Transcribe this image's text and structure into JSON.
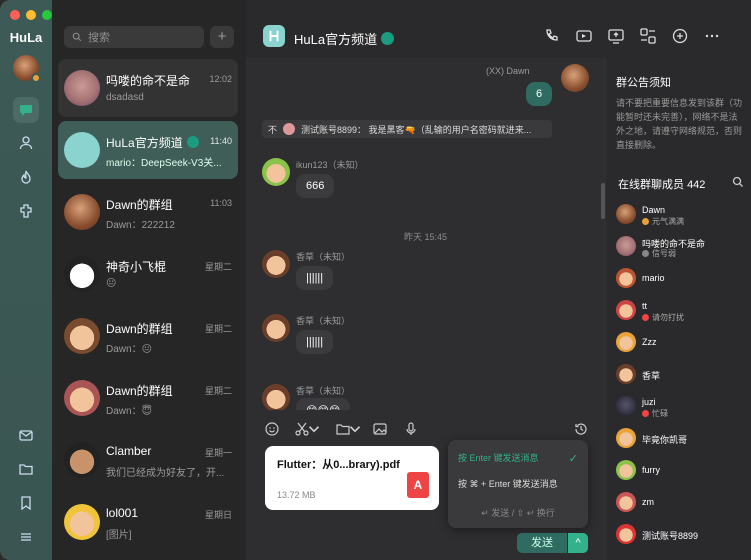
{
  "app": {
    "name": "HuLa"
  },
  "sidebar": {
    "items": [
      "message",
      "contacts",
      "hot",
      "plugins",
      "mail",
      "folder",
      "bookmark",
      "menu"
    ]
  },
  "search": {
    "placeholder": "搜索",
    "add_label": "+"
  },
  "chats": [
    {
      "name": "吗喽的命不是命",
      "time": "12:02",
      "preview": "dsadasd"
    },
    {
      "name": "HuLa官方频道",
      "time": "11:40",
      "preview": "mario：DeepSeek-V3关..."
    },
    {
      "name": "Dawn的群组",
      "time": "11:03",
      "preview": "Dawn：222212"
    },
    {
      "name": "神奇小飞棍",
      "time": "星期二",
      "preview": "😐"
    },
    {
      "name": "Dawn的群组",
      "time": "星期二",
      "preview": "Dawn：😐"
    },
    {
      "name": "Dawn的群组",
      "time": "星期二",
      "preview": "Dawn：😇"
    },
    {
      "name": "Clamber",
      "time": "星期一",
      "preview": "我们已经成为好友了，开..."
    },
    {
      "name": "lol001",
      "time": "星期日",
      "preview": "[图片]"
    }
  ],
  "header": {
    "title": "HuLa官方频道",
    "icons": [
      "phone-icon",
      "video-icon",
      "screen-share-icon",
      "apps-icon",
      "add-circle-icon",
      "more-icon"
    ]
  },
  "messages": {
    "dawn_sender": "(XX) Dawn",
    "dawn_text": "6",
    "notice_prefix": "不",
    "notice_text": "测试账号8899：  我是黑客🔫（乱输的用户名密码就进来...",
    "ikun_sender": "ikun123（未知）",
    "ikun_text": "666",
    "time_divider": "昨天 15:45",
    "xc_sender": "香草（未知）",
    "xc1_text": "||||||",
    "xc2_text": "||||||",
    "xc3_text": "😊😊😊"
  },
  "file": {
    "name": "Flutter：从0...brary).pdf",
    "size": "13.72 MB",
    "type_label": "A"
  },
  "send_menu": {
    "opt1": "按 Enter 键发送消息",
    "opt2": "按 ⌘ + Enter 键发送消息",
    "hint": "↵ 发送 / ⇧ ↵ 换行",
    "check": "✓"
  },
  "send": {
    "label": "发送",
    "arrow": "^"
  },
  "panel": {
    "notice_title": "群公告须知",
    "notice_body": "请不要把重要信息发到该群（功能暂时还未完善），网络不是法外之地，请遵守网络规范，否则直接删除。",
    "members_title": "在线群聊成员",
    "members_count": "442",
    "members": [
      {
        "name": "Dawn",
        "status": "元气满满"
      },
      {
        "name": "吗喽的命不是命",
        "status": "信号弱"
      },
      {
        "name": "mario",
        "status": ""
      },
      {
        "name": "tt",
        "status": "请勿打扰"
      },
      {
        "name": "Zzz",
        "status": ""
      },
      {
        "name": "香草",
        "status": ""
      },
      {
        "name": "juzi",
        "status": "忙碌"
      },
      {
        "name": "毕竟你凯哥",
        "status": ""
      },
      {
        "name": "furry",
        "status": ""
      },
      {
        "name": "zm",
        "status": ""
      },
      {
        "name": "测试账号8899",
        "status": ""
      }
    ]
  },
  "colors": {
    "accent": "#32b18b",
    "rail": "#3d5a56",
    "active_item": "#3e5e57",
    "my_bubble": "#2f6b60"
  }
}
